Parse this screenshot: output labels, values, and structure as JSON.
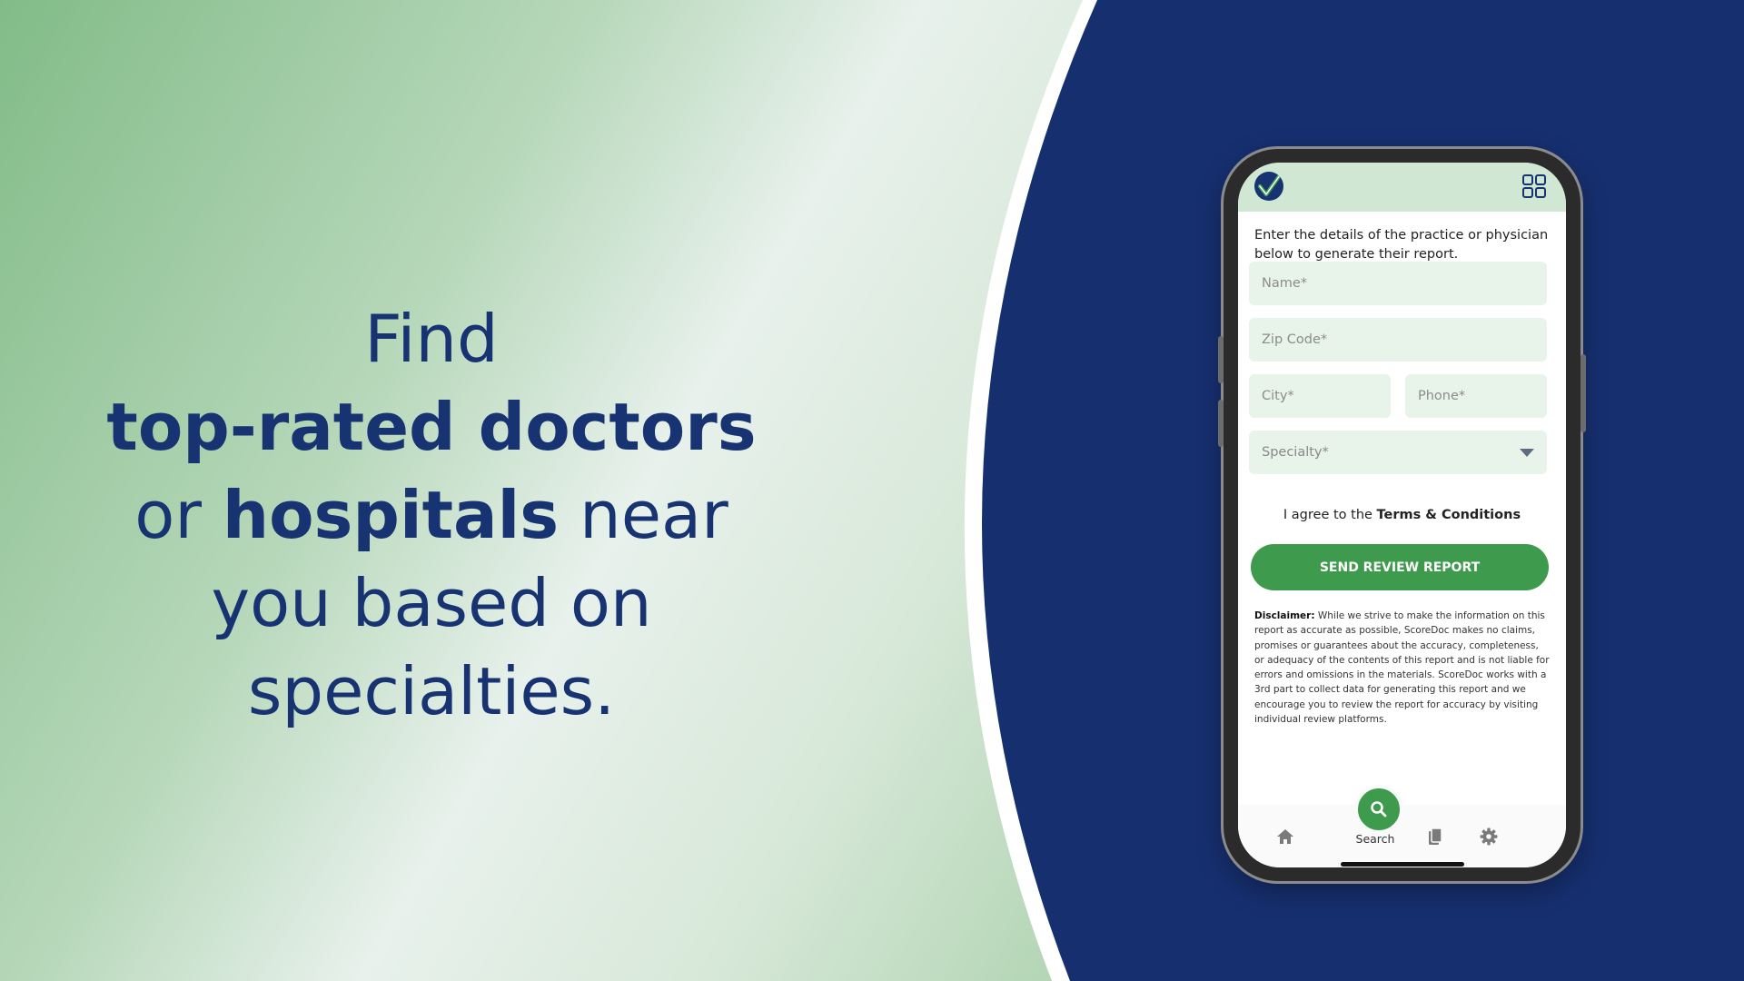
{
  "headline": {
    "line1": "Find",
    "line2_bold": "top-rated doctors",
    "line3_pre": "or ",
    "line3_bold": "hospitals",
    "line3_post": " near",
    "line4": "you based on",
    "line5": "specialties."
  },
  "colors": {
    "navy": "#162f6f",
    "green": "#3e9a4c",
    "field_bg": "#e8f3ea",
    "header_bg": "#d0e7d3"
  },
  "app": {
    "logo_icon": "checkmark-logo-icon",
    "menu_icon": "grid-icon",
    "intro": "Enter the details of the practice or physician below to generate their report.",
    "form": {
      "name_placeholder": "Name*",
      "zip_placeholder": "Zip Code*",
      "city_placeholder": "City*",
      "phone_placeholder": "Phone*",
      "specialty_placeholder": "Specialty*"
    },
    "agree_pre": "I agree to the ",
    "agree_link": "Terms & Conditions",
    "send_button": "SEND REVIEW REPORT",
    "disclaimer_label": "Disclaimer:",
    "disclaimer_text": "While we strive to make the information on this report as accurate as possible, ScoreDoc makes no claims, promises or guarantees about the accuracy, completeness, or adequacy of the contents of this report and is not liable for errors and omissions in the materials. ScoreDoc works with a 3rd part to collect data for generating this report and we encourage you to review the report for accuracy by visiting individual review platforms.",
    "nav": {
      "home_icon": "home-icon",
      "search_label": "Search",
      "search_icon": "search-icon",
      "documents_icon": "documents-icon",
      "settings_icon": "gear-icon"
    }
  }
}
